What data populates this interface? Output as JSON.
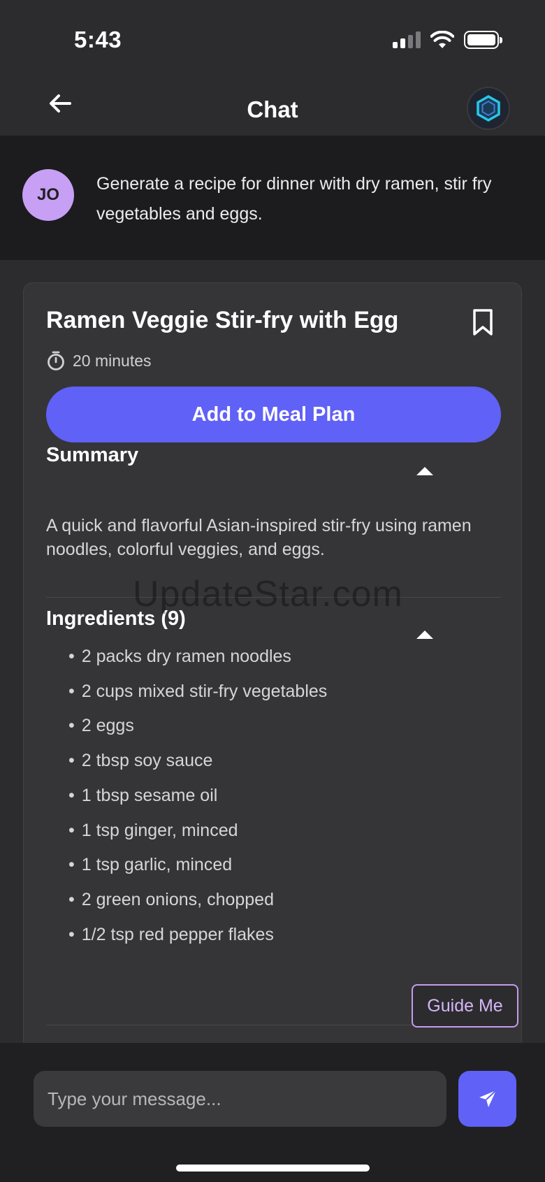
{
  "status_bar": {
    "time": "5:43"
  },
  "nav": {
    "title": "Chat"
  },
  "user_message": {
    "initials": "JO",
    "text": "Generate a recipe for dinner with dry ramen, stir fry vegetables and eggs."
  },
  "recipe": {
    "title": "Ramen Veggie Stir-fry with Egg",
    "time": "20 minutes",
    "add_button_label": "Add to Meal Plan",
    "summary_heading": "Summary",
    "summary_text": "A quick and flavorful Asian-inspired stir-fry using ramen noodles, colorful veggies, and eggs.",
    "ingredients_heading": "Ingredients (9)",
    "ingredients": [
      "2 packs dry ramen noodles",
      "2 cups mixed stir-fry vegetables",
      "2 eggs",
      "2 tbsp soy sauce",
      "1 tbsp sesame oil",
      "1 tsp ginger, minced",
      "1 tsp garlic, minced",
      "2 green onions, chopped",
      "1/2 tsp red pepper flakes"
    ]
  },
  "watermark": "UpdateStar.com",
  "guide_button_label": "Guide Me",
  "composer": {
    "placeholder": "Type your message..."
  },
  "colors": {
    "accent": "#6061f6",
    "guide_border": "#c59cf0",
    "avatar_bg": "#c7a0f5",
    "background": "#2c2c2e",
    "card": "#353537"
  },
  "icons": {
    "back": "arrow-left-icon",
    "ai": "hexagon-icon",
    "bookmark": "bookmark-icon",
    "timer": "stopwatch-icon",
    "collapse": "caret-up-icon",
    "send": "paper-plane-icon"
  }
}
